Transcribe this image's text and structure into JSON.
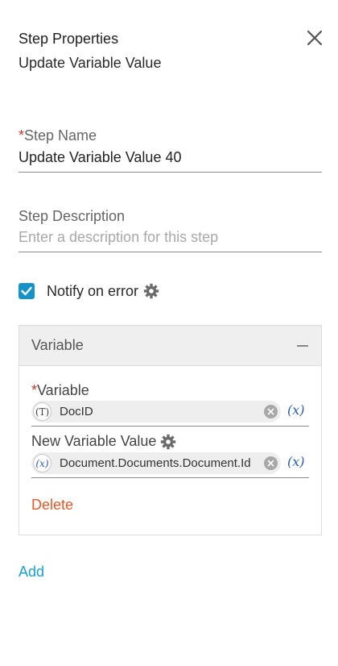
{
  "header": {
    "title": "Step Properties",
    "subtitle": "Update Variable Value",
    "close_icon": "close-icon"
  },
  "step_name": {
    "required_mark": "*",
    "label": "Step Name",
    "value": "Update Variable Value 40"
  },
  "step_description": {
    "label": "Step Description",
    "placeholder": "Enter a description for this step"
  },
  "notify": {
    "label": "Notify on error",
    "checked": true,
    "icon": "gear-icon"
  },
  "variable_panel": {
    "title": "Variable",
    "variable": {
      "required_mark": "*",
      "label": "Variable",
      "badge": "(T)",
      "value": "DocID",
      "fx": "(x)"
    },
    "new_value": {
      "label": "New Variable Value",
      "badge": "(x)",
      "value": "Document.Documents.Document.Id",
      "fx": "(x)"
    },
    "delete_label": "Delete"
  },
  "add_label": "Add",
  "colors": {
    "accent": "#1593c9",
    "link": "#1a9fd0",
    "danger": "#e05a2b",
    "required": "#c0392b",
    "expression": "#2a5caa"
  }
}
